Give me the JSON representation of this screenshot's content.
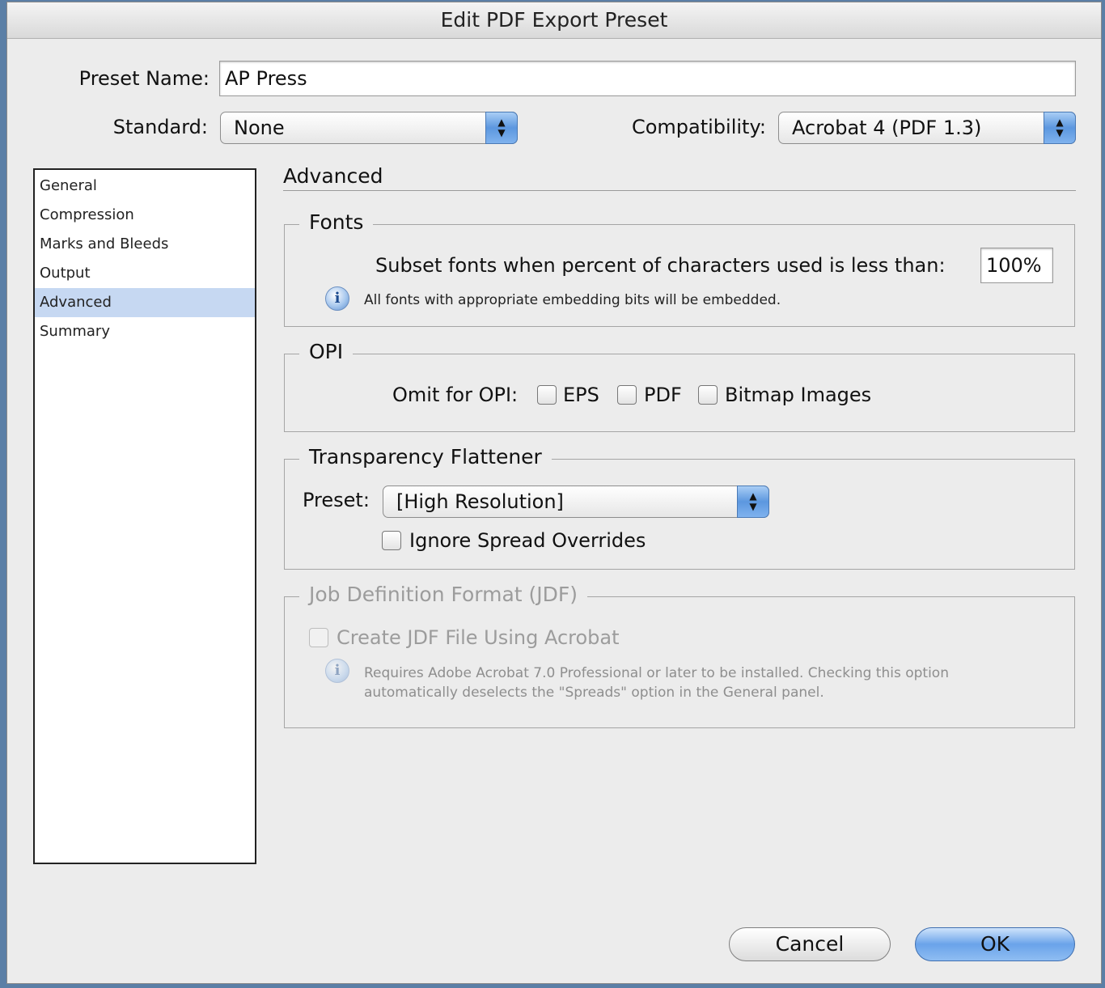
{
  "dialog": {
    "title": "Edit PDF Export Preset"
  },
  "preset_name": {
    "label": "Preset Name:",
    "value": "AP Press"
  },
  "standard": {
    "label": "Standard:",
    "value": "None"
  },
  "compatibility": {
    "label": "Compatibility:",
    "value": "Acrobat 4 (PDF 1.3)"
  },
  "sidebar": {
    "items": [
      {
        "label": "General"
      },
      {
        "label": "Compression"
      },
      {
        "label": "Marks and Bleeds"
      },
      {
        "label": "Output"
      },
      {
        "label": "Advanced",
        "selected": true
      },
      {
        "label": "Summary"
      }
    ]
  },
  "section": {
    "title": "Advanced"
  },
  "fonts": {
    "title": "Fonts",
    "subset_label": "Subset fonts when percent of characters used is less than:",
    "subset_value": "100%",
    "info_text": "All fonts with appropriate embedding bits will be embedded."
  },
  "opi": {
    "title": "OPI",
    "omit_label": "Omit for OPI:",
    "eps_label": "EPS",
    "pdf_label": "PDF",
    "bitmap_label": "Bitmap Images"
  },
  "flattener": {
    "title": "Transparency Flattener",
    "preset_label": "Preset:",
    "preset_value": "[High Resolution]",
    "ignore_label": "Ignore Spread Overrides"
  },
  "jdf": {
    "title": "Job Definition Format (JDF)",
    "create_label": "Create JDF File Using Acrobat",
    "info_line1": "Requires Adobe Acrobat 7.0 Professional or later to be installed. Checking this option",
    "info_line2": "automatically deselects the \"Spreads\" option in the General panel."
  },
  "buttons": {
    "cancel": "Cancel",
    "ok": "OK"
  },
  "colors": {
    "selection": "#c6d8f2",
    "accent": "#6aa3ea"
  }
}
